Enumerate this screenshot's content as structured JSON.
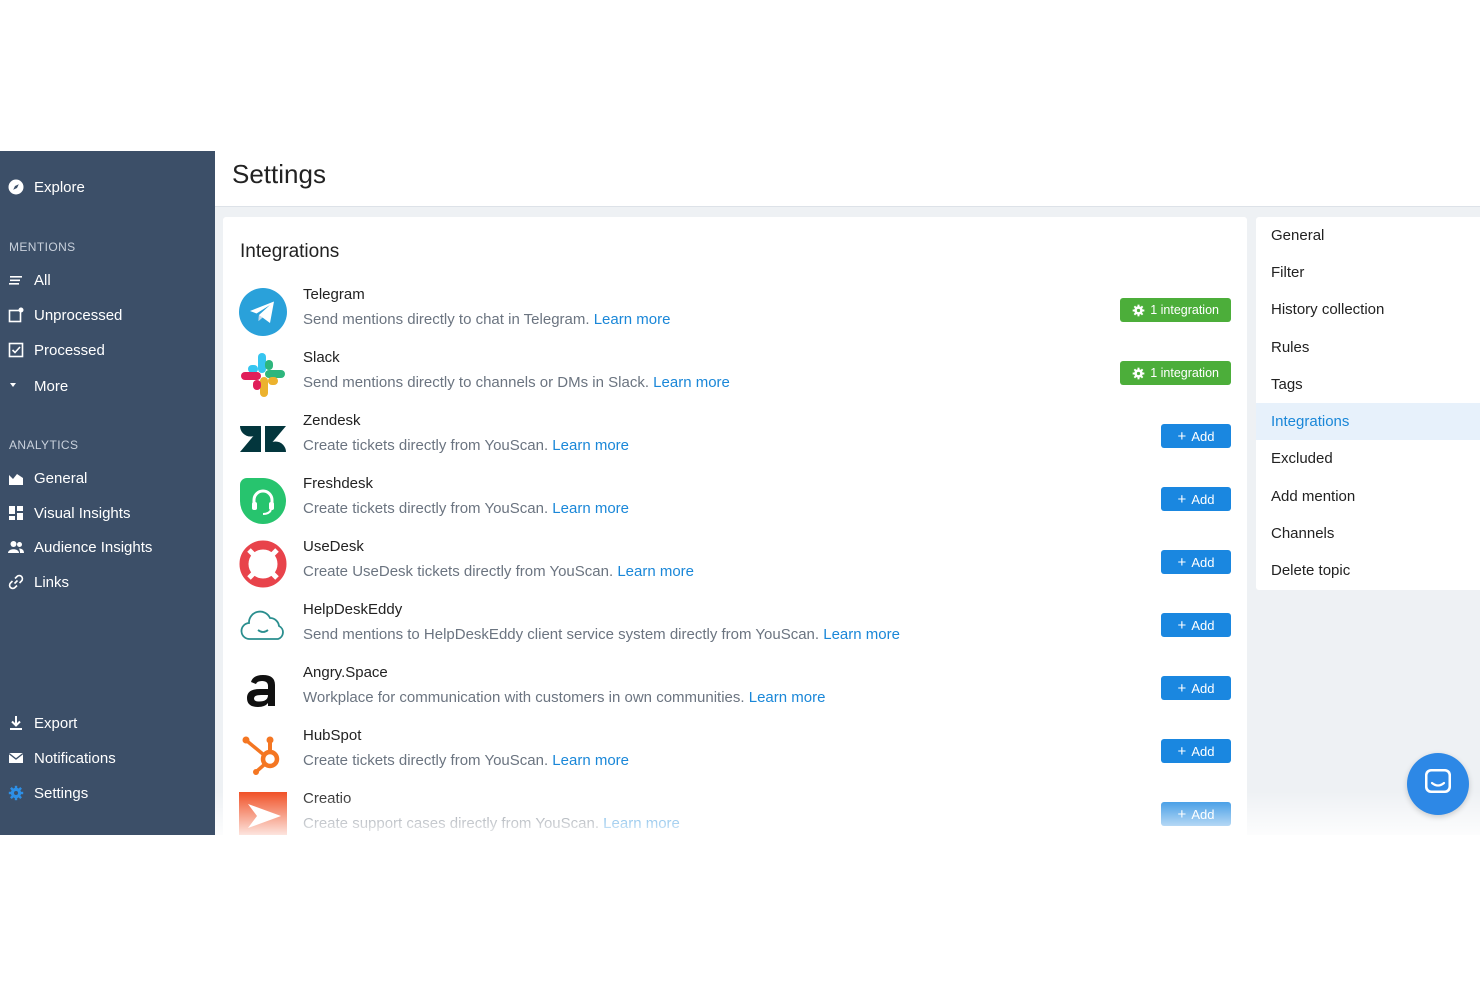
{
  "header": {
    "title": "Settings"
  },
  "sidebar": {
    "explore": "Explore",
    "mentions_label": "MENTIONS",
    "mentions": [
      "All",
      "Unprocessed",
      "Processed",
      "More"
    ],
    "analytics_label": "ANALYTICS",
    "analytics": [
      "General",
      "Visual Insights",
      "Audience Insights",
      "Links"
    ],
    "bottom": [
      "Export",
      "Notifications",
      "Settings"
    ]
  },
  "integrations": {
    "title": "Integrations",
    "learn_more": "Learn more",
    "add_label": "Add",
    "integration_label": "1 integration",
    "items": [
      {
        "name": "Telegram",
        "desc": "Send mentions directly to chat in Telegram.",
        "status": "1 integration"
      },
      {
        "name": "Slack",
        "desc": "Send mentions directly to channels or DMs in Slack.",
        "status": "1 integration"
      },
      {
        "name": "Zendesk",
        "desc": "Create tickets directly from YouScan.",
        "status": "Add"
      },
      {
        "name": "Freshdesk",
        "desc": "Create tickets directly from YouScan.",
        "status": "Add"
      },
      {
        "name": "UseDesk",
        "desc": "Create UseDesk tickets directly from YouScan.",
        "status": "Add"
      },
      {
        "name": "HelpDeskEddy",
        "desc": "Send mentions to HelpDeskEddy client service system directly from YouScan.",
        "status": "Add"
      },
      {
        "name": "Angry.Space",
        "desc": "Workplace for communication with customers in own communities.",
        "status": "Add"
      },
      {
        "name": "HubSpot",
        "desc": "Create tickets directly from YouScan.",
        "status": "Add"
      },
      {
        "name": "Creatio",
        "desc": "Create support cases directly from YouScan.",
        "status": "Add"
      }
    ]
  },
  "settings_menu": {
    "items": [
      "General",
      "Filter",
      "History collection",
      "Rules",
      "Tags",
      "Integrations",
      "Excluded",
      "Add mention",
      "Channels",
      "Delete topic"
    ],
    "active": "Integrations"
  },
  "colors": {
    "sidebar": "#3c4f68",
    "accent": "#1a87d8",
    "success": "#4cae3a"
  }
}
